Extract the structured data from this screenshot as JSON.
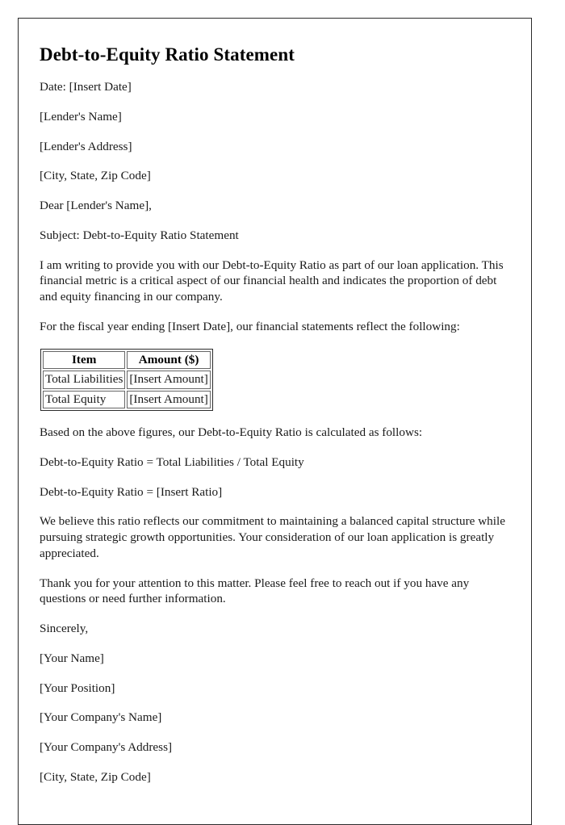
{
  "document": {
    "title": "Debt-to-Equity Ratio Statement",
    "date_line": "Date: [Insert Date]",
    "recipient": {
      "name": "[Lender's Name]",
      "address": "[Lender's Address]",
      "city_state_zip": "[City, State, Zip Code]"
    },
    "salutation": "Dear [Lender's Name],",
    "subject_line": "Subject: Debt-to-Equity Ratio Statement",
    "intro_paragraph": "I am writing to provide you with our Debt-to-Equity Ratio as part of our loan application. This financial metric is a critical aspect of our financial health and indicates the proportion of debt and equity financing in our company.",
    "fiscal_year_line": "For the fiscal year ending [Insert Date], our financial statements reflect the following:",
    "table": {
      "headers": [
        "Item",
        "Amount ($)"
      ],
      "rows": [
        [
          "Total Liabilities",
          "[Insert Amount]"
        ],
        [
          "Total Equity",
          "[Insert Amount]"
        ]
      ]
    },
    "based_on_line": "Based on the above figures, our Debt-to-Equity Ratio is calculated as follows:",
    "formula_line": "Debt-to-Equity Ratio = Total Liabilities / Total Equity",
    "result_line": "Debt-to-Equity Ratio = [Insert Ratio]",
    "belief_paragraph": "We believe this ratio reflects our commitment to maintaining a balanced capital structure while pursuing strategic growth opportunities. Your consideration of our loan application is greatly appreciated.",
    "thanks_paragraph": "Thank you for your attention to this matter. Please feel free to reach out if you have any questions or need further information.",
    "closing": "Sincerely,",
    "signature": {
      "name": "[Your Name]",
      "position": "[Your Position]",
      "company_name": "[Your Company's Name]",
      "company_address": "[Your Company's Address]",
      "company_city_state_zip": "[City, State, Zip Code]"
    }
  }
}
